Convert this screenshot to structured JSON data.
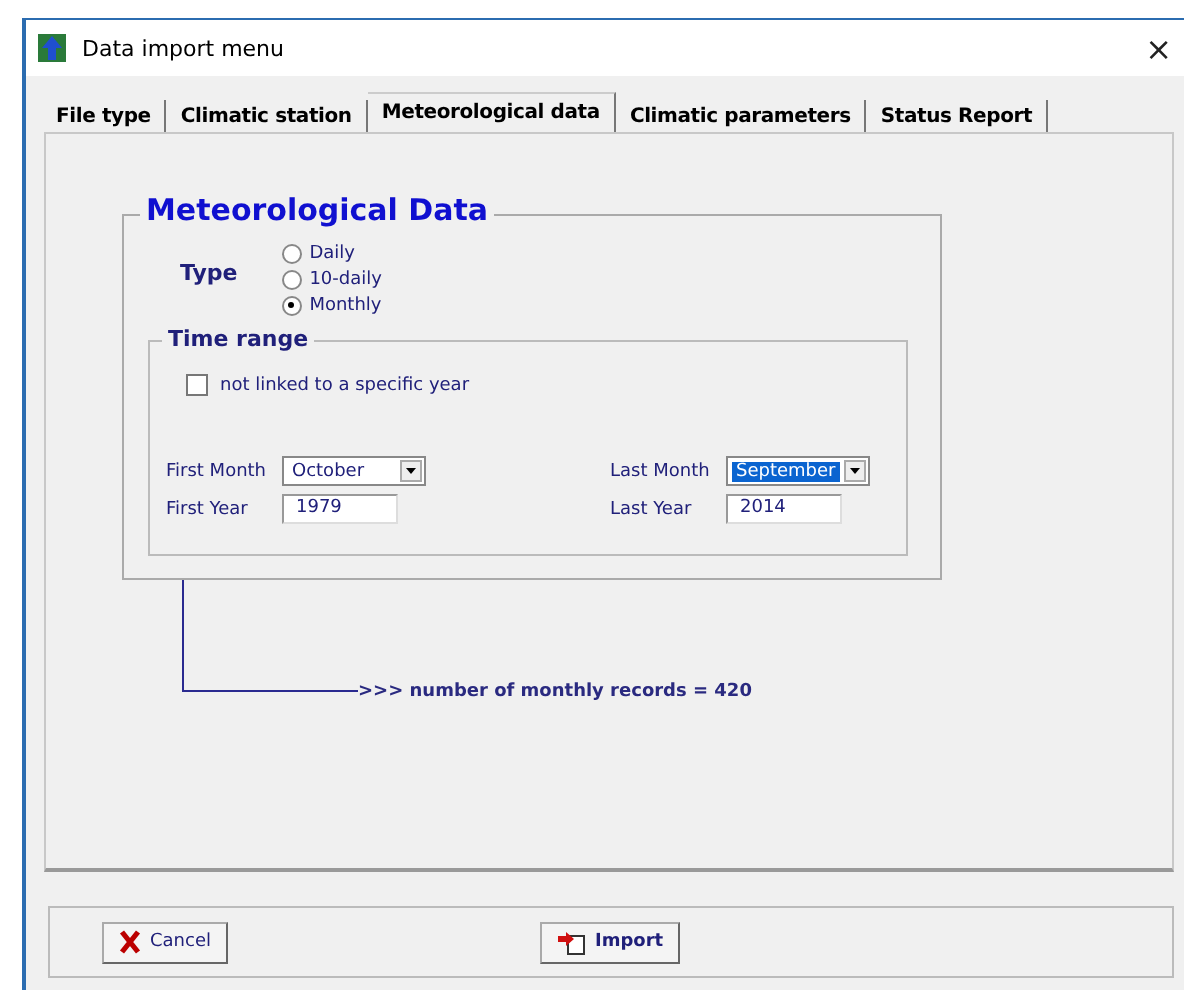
{
  "window": {
    "title": "Data import menu",
    "close": "×"
  },
  "tabs": [
    {
      "label": "File type",
      "selected": false
    },
    {
      "label": "Climatic station",
      "selected": false
    },
    {
      "label": "Meteorological data",
      "selected": true
    },
    {
      "label": "Climatic parameters",
      "selected": false
    },
    {
      "label": "Status Report",
      "selected": false
    }
  ],
  "group": {
    "title": "Meteorological Data",
    "type_label": "Type",
    "type_options": [
      {
        "label": "Daily",
        "selected": false
      },
      {
        "label": "10-daily",
        "selected": false
      },
      {
        "label": "Monthly",
        "selected": true
      }
    ],
    "time_range": {
      "title": "Time range",
      "checkbox": {
        "label": "not linked to a specific year",
        "checked": false
      },
      "first_month": {
        "label": "First Month",
        "value": "October",
        "highlighted": false
      },
      "first_year": {
        "label": "First Year",
        "value": "1979"
      },
      "last_month": {
        "label": "Last Month",
        "value": "September",
        "highlighted": true
      },
      "last_year": {
        "label": "Last Year",
        "value": "2014"
      }
    }
  },
  "result": ">>> number of monthly records = 420",
  "buttons": [
    {
      "kind": "cancel",
      "label": "Cancel"
    },
    {
      "kind": "import",
      "label": "Import"
    }
  ]
}
